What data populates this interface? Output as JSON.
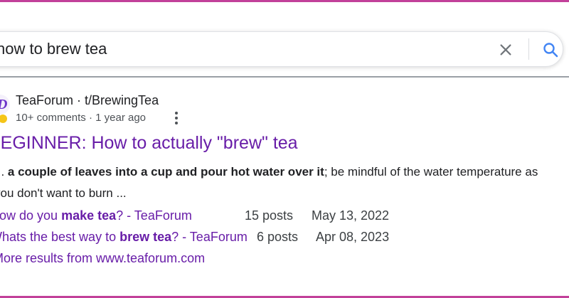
{
  "search": {
    "query": "how to brew tea",
    "clear_icon": "close-icon",
    "search_icon": "search-icon"
  },
  "result": {
    "site_name": "TeaForum · t/BrewingTea",
    "meta": "10+ comments · 1 year ago",
    "title": "BEGINNER: How to actually \"brew\" tea",
    "snippet": {
      "line1_lead": "...",
      "line1_bold": "a couple of leaves into a cup and pour hot water over it",
      "line1_rest": "; be mindful of the water temperature as",
      "line2": "you don't want to burn ..."
    },
    "sitelinks": [
      {
        "pre": "How do you ",
        "bold": "make tea",
        "post": "? - TeaForum",
        "posts": "15 posts",
        "date": "May 13, 2022"
      },
      {
        "pre": "Whats the best way to ",
        "bold": "brew tea",
        "post": "? - TeaForum",
        "posts": "6 posts",
        "date": "Apr 08, 2023"
      }
    ],
    "more_results": "More results from www.teaforum.com"
  },
  "colors": {
    "link_visited": "#681da8",
    "frame_border": "#c2409a",
    "text": "#202124",
    "meta": "#4d5156"
  }
}
